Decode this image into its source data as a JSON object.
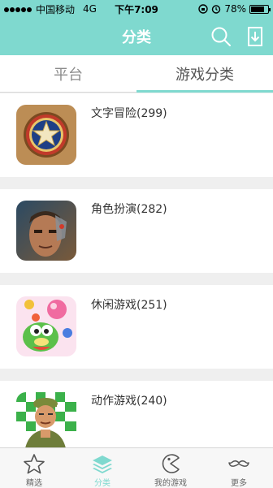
{
  "status_bar": {
    "carrier": "中国移动",
    "network": "4G",
    "time": "下午7:09",
    "battery": "78%",
    "battery_level": 0.78
  },
  "nav": {
    "title": "分类",
    "search_icon": "search-icon",
    "download_icon": "download-icon"
  },
  "tabs": [
    {
      "label": "平台",
      "active": false
    },
    {
      "label": "游戏分类",
      "active": true
    }
  ],
  "categories": [
    {
      "label": "文字冒险(299)"
    },
    {
      "label": "角色扮演(282)"
    },
    {
      "label": "休闲游戏(251)"
    },
    {
      "label": "动作游戏(240)"
    }
  ],
  "tabbar": [
    {
      "label": "精选",
      "icon": "star-icon",
      "active": false
    },
    {
      "label": "分类",
      "icon": "layers-icon",
      "active": true
    },
    {
      "label": "我的游戏",
      "icon": "pacman-icon",
      "active": false
    },
    {
      "label": "更多",
      "icon": "mustache-icon",
      "active": false
    }
  ],
  "colors": {
    "accent": "#7fd9cf",
    "background": "#efefef"
  }
}
